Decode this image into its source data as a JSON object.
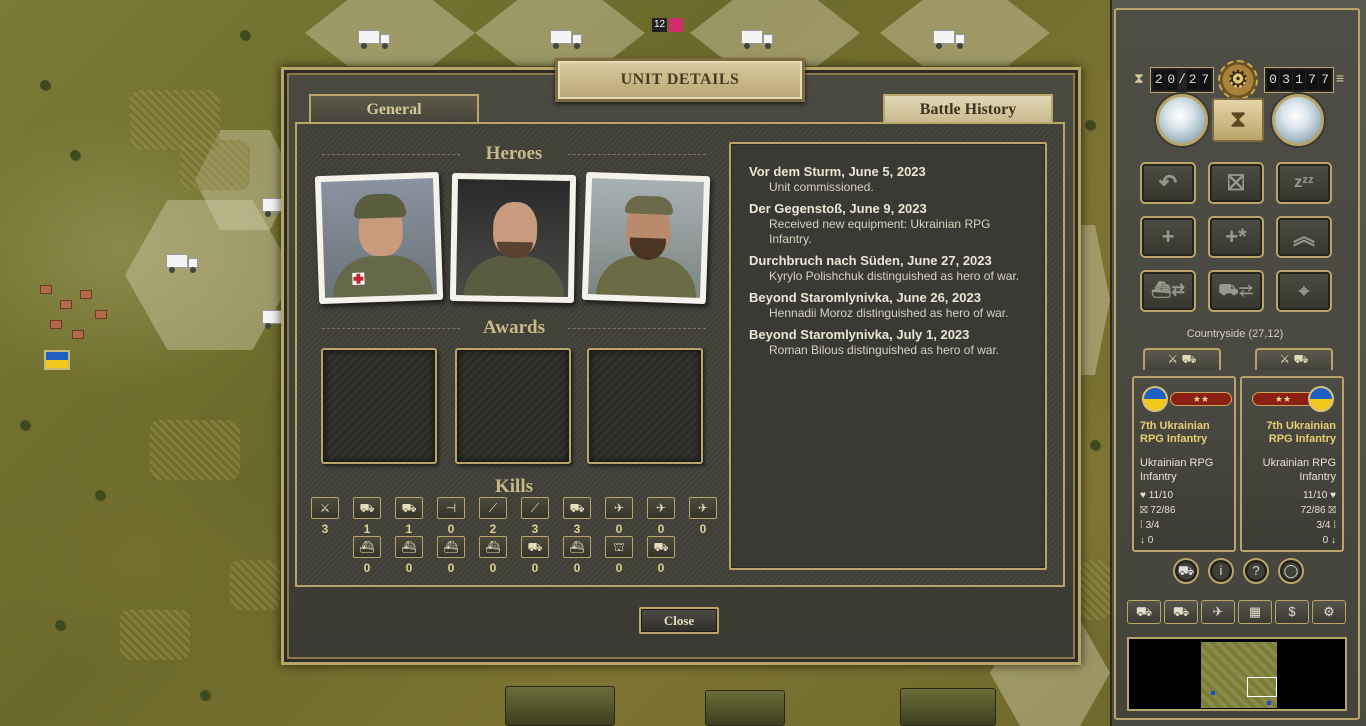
{
  "dialog": {
    "title": "UNIT DETAILS",
    "tabs": [
      {
        "label": "General",
        "active": false
      },
      {
        "label": "Battle History",
        "active": true
      }
    ],
    "sections": {
      "heroes": "Heroes",
      "awards": "Awards",
      "kills": "Kills"
    },
    "heroes_count": 3,
    "award_slots_count": 3,
    "kills_row1": [
      {
        "icon": "infantry-icon",
        "count": "3"
      },
      {
        "icon": "tank-icon",
        "count": "1"
      },
      {
        "icon": "recon-icon",
        "count": "1"
      },
      {
        "icon": "anti-tank-icon",
        "count": "0"
      },
      {
        "icon": "artillery-icon",
        "count": "2"
      },
      {
        "icon": "anti-air-icon",
        "count": "3"
      },
      {
        "icon": "air-defense-icon",
        "count": "3"
      },
      {
        "icon": "fighter-icon",
        "count": "0"
      },
      {
        "icon": "tactical-bomber-icon",
        "count": "0"
      },
      {
        "icon": "strategic-bomber-icon",
        "count": "0"
      }
    ],
    "kills_row2": [
      {
        "icon": "submarine-icon",
        "count": "0"
      },
      {
        "icon": "destroyer-icon",
        "count": "0"
      },
      {
        "icon": "capital-ship-icon",
        "count": "0"
      },
      {
        "icon": "carrier-icon",
        "count": "0"
      },
      {
        "icon": "transport-icon",
        "count": "0"
      },
      {
        "icon": "landing-craft-icon",
        "count": "0"
      },
      {
        "icon": "fortification-icon",
        "count": "0"
      },
      {
        "icon": "train-icon",
        "count": "0"
      }
    ],
    "battle_history": [
      {
        "title": "Vor dem Sturm, June 5, 2023",
        "desc": "Unit commissioned."
      },
      {
        "title": "Der Gegenstoß, June 9, 2023",
        "desc": "Received new equipment: Ukrainian RPG Infantry."
      },
      {
        "title": "Durchbruch nach Süden, June 27, 2023",
        "desc": "Kyrylo Polishchuk distinguished as hero of war."
      },
      {
        "title": "Beyond Staromlynivka, June 26, 2023",
        "desc": "Hennadii Moroz distinguished as hero of war."
      },
      {
        "title": "Beyond Staromlynivka, July 1, 2023",
        "desc": "Roman Bilous distinguished as hero of war."
      }
    ],
    "close_label": "Close"
  },
  "map": {
    "top_unit_strength": "12"
  },
  "side": {
    "turn_current": [
      "2",
      "0"
    ],
    "turn_sep": "/",
    "turn_total": [
      "2",
      "7"
    ],
    "prestige": [
      "0",
      "3",
      "1",
      "7",
      "7"
    ],
    "terrain_info": "Countryside (27,12)",
    "unit_cards": [
      {
        "name": "7th Ukrainian RPG Infantry",
        "type": "Ukrainian RPG Infantry",
        "strength": "11/10",
        "experience": "72/86",
        "ammo": "3/4",
        "entrench": "0"
      },
      {
        "name": "7th Ukrainian RPG Infantry",
        "type": "Ukrainian RPG Infantry",
        "strength": "11/10",
        "experience": "72/86",
        "ammo": "3/4",
        "entrench": "0"
      }
    ],
    "stars": "★★",
    "money_symbol": "$"
  },
  "colors": {
    "gold_border": "#b9a46a",
    "title_text": "#4a3c20",
    "kill_count": "#e1cf95",
    "unit_name": "#e8cf72"
  }
}
